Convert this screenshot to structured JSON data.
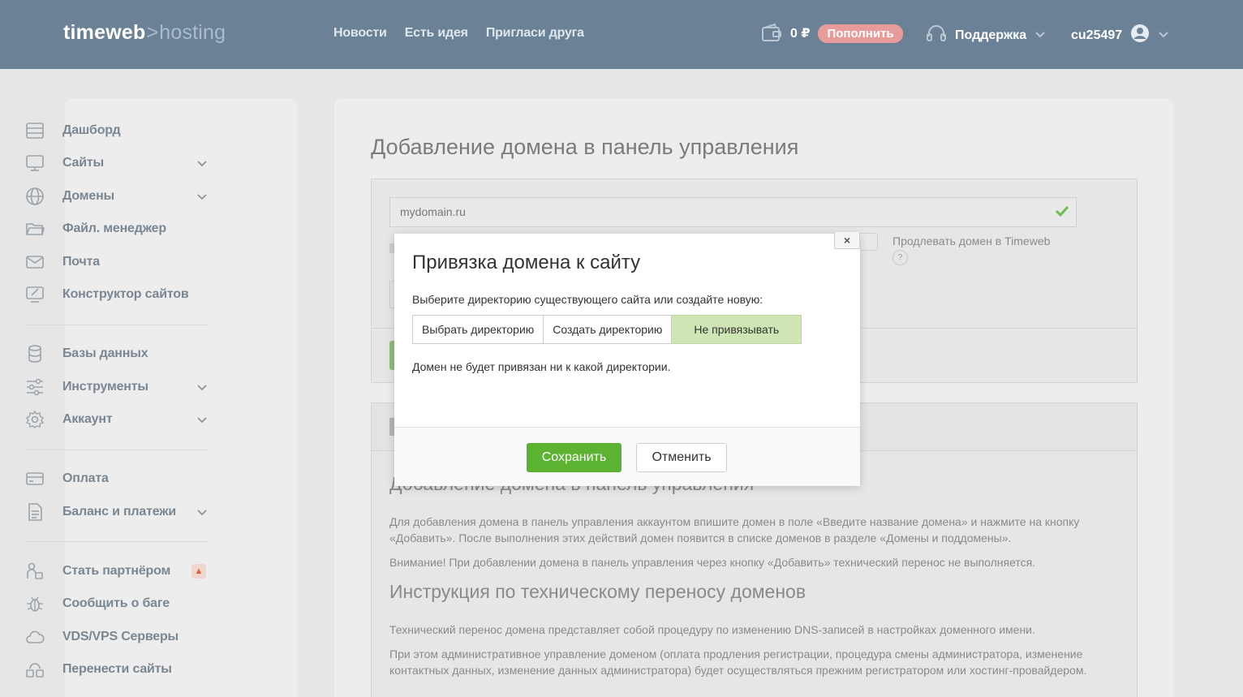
{
  "header": {
    "logo_main": "timeweb",
    "logo_sep": ">",
    "logo_sub": "hosting",
    "nav": [
      "Новости",
      "Есть идея",
      "Пригласи друга"
    ],
    "balance": "0 ₽",
    "topup_label": "Пополнить",
    "support_label": "Поддержка",
    "username": "cu25497"
  },
  "sidebar": {
    "items": [
      {
        "label": "Дашборд",
        "icon": "dashboard-icon"
      },
      {
        "label": "Сайты",
        "icon": "monitor-icon"
      },
      {
        "label": "Домены",
        "icon": "globe-icon"
      },
      {
        "label": "Файл. менеджер",
        "icon": "folder-icon"
      },
      {
        "label": "Почта",
        "icon": "mail-icon"
      },
      {
        "label": "Конструктор сайтов",
        "icon": "builder-icon"
      },
      {
        "label": "Базы данных",
        "icon": "database-icon"
      },
      {
        "label": "Инструменты",
        "icon": "sliders-icon"
      },
      {
        "label": "Аккаунт",
        "icon": "gear-icon"
      },
      {
        "label": "Оплата",
        "icon": "card-icon"
      },
      {
        "label": "Баланс и платежи",
        "icon": "document-icon"
      },
      {
        "label": "Стать партнёром",
        "icon": "partner-icon"
      },
      {
        "label": "Сообщить о баге",
        "icon": "bug-icon"
      },
      {
        "label": "VDS/VPS Серверы",
        "icon": "cloud-icon"
      },
      {
        "label": "Перенести сайты",
        "icon": "transfer-icon"
      }
    ]
  },
  "main": {
    "title": "Добавление домена в панель управления",
    "domain_value": "mydomain.ru",
    "renew_label": "Продлевать домен в Timeweb",
    "help_mark": "?",
    "section_heading": "Добавление домена в панель управления",
    "para1": "Для добавления домена в панель управления аккаунтом впишите домен в поле «Введите название домена» и нажмите на кнопку «Добавить». После выполнения этих действий домен появится в списке доменов в разделе «Домены и поддомены».",
    "para2": "Внимание! При добавлении домена в панель управления через кнопку «Добавить» технический перенос не выполняется.",
    "heading2": "Инструкция по техническому переносу доменов",
    "para3": "Технический перенос домена представляет собой процедуру по изменению DNS-записей в настройках доменного имени.",
    "para4": "При этом административное управление доменом (оплата продления регистрации, процедура смены администратора, изменение контактных данных, изменение данных администратора) будет осуществляться прежним регистратором или хостинг-провайдером."
  },
  "modal": {
    "close": "×",
    "title": "Привязка домена к сайту",
    "description": "Выберите директорию существующего сайта или создайте новую:",
    "options": [
      "Выбрать директорию",
      "Создать директорию",
      "Не привязывать"
    ],
    "selected_option": "Не привязывать",
    "info": "Домен не будет привязан ни к какой директории.",
    "save_label": "Сохранить",
    "cancel_label": "Отменить"
  },
  "colors": {
    "header_bg": "#6a8196",
    "accent_green": "#5cb332",
    "topup_bg": "#e89b9b",
    "selected_option_bg": "#cfe6b4"
  }
}
